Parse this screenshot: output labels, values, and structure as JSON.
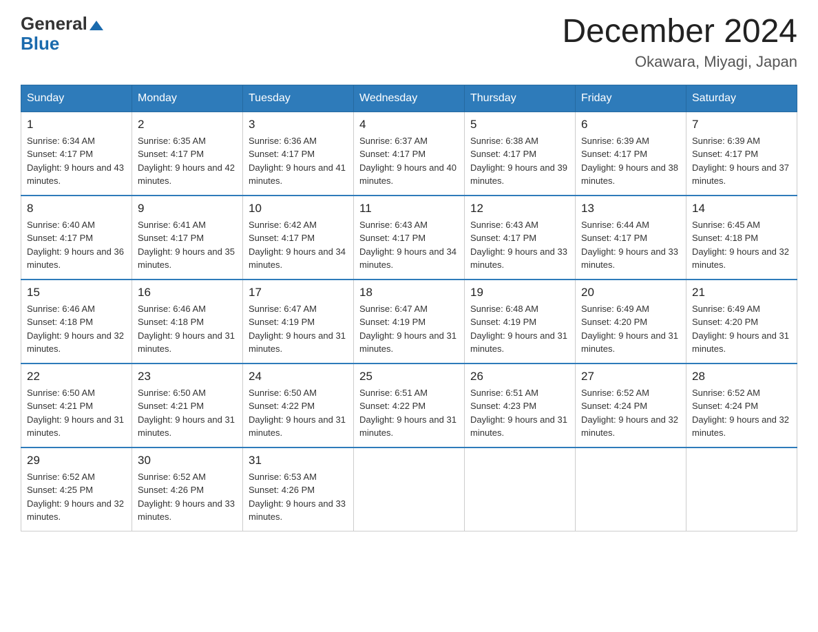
{
  "header": {
    "logo_general": "General",
    "logo_blue": "Blue",
    "month_title": "December 2024",
    "location": "Okawara, Miyagi, Japan"
  },
  "weekdays": [
    "Sunday",
    "Monday",
    "Tuesday",
    "Wednesday",
    "Thursday",
    "Friday",
    "Saturday"
  ],
  "weeks": [
    [
      {
        "day": "1",
        "sunrise": "6:34 AM",
        "sunset": "4:17 PM",
        "daylight": "9 hours and 43 minutes."
      },
      {
        "day": "2",
        "sunrise": "6:35 AM",
        "sunset": "4:17 PM",
        "daylight": "9 hours and 42 minutes."
      },
      {
        "day": "3",
        "sunrise": "6:36 AM",
        "sunset": "4:17 PM",
        "daylight": "9 hours and 41 minutes."
      },
      {
        "day": "4",
        "sunrise": "6:37 AM",
        "sunset": "4:17 PM",
        "daylight": "9 hours and 40 minutes."
      },
      {
        "day": "5",
        "sunrise": "6:38 AM",
        "sunset": "4:17 PM",
        "daylight": "9 hours and 39 minutes."
      },
      {
        "day": "6",
        "sunrise": "6:39 AM",
        "sunset": "4:17 PM",
        "daylight": "9 hours and 38 minutes."
      },
      {
        "day": "7",
        "sunrise": "6:39 AM",
        "sunset": "4:17 PM",
        "daylight": "9 hours and 37 minutes."
      }
    ],
    [
      {
        "day": "8",
        "sunrise": "6:40 AM",
        "sunset": "4:17 PM",
        "daylight": "9 hours and 36 minutes."
      },
      {
        "day": "9",
        "sunrise": "6:41 AM",
        "sunset": "4:17 PM",
        "daylight": "9 hours and 35 minutes."
      },
      {
        "day": "10",
        "sunrise": "6:42 AM",
        "sunset": "4:17 PM",
        "daylight": "9 hours and 34 minutes."
      },
      {
        "day": "11",
        "sunrise": "6:43 AM",
        "sunset": "4:17 PM",
        "daylight": "9 hours and 34 minutes."
      },
      {
        "day": "12",
        "sunrise": "6:43 AM",
        "sunset": "4:17 PM",
        "daylight": "9 hours and 33 minutes."
      },
      {
        "day": "13",
        "sunrise": "6:44 AM",
        "sunset": "4:17 PM",
        "daylight": "9 hours and 33 minutes."
      },
      {
        "day": "14",
        "sunrise": "6:45 AM",
        "sunset": "4:18 PM",
        "daylight": "9 hours and 32 minutes."
      }
    ],
    [
      {
        "day": "15",
        "sunrise": "6:46 AM",
        "sunset": "4:18 PM",
        "daylight": "9 hours and 32 minutes."
      },
      {
        "day": "16",
        "sunrise": "6:46 AM",
        "sunset": "4:18 PM",
        "daylight": "9 hours and 31 minutes."
      },
      {
        "day": "17",
        "sunrise": "6:47 AM",
        "sunset": "4:19 PM",
        "daylight": "9 hours and 31 minutes."
      },
      {
        "day": "18",
        "sunrise": "6:47 AM",
        "sunset": "4:19 PM",
        "daylight": "9 hours and 31 minutes."
      },
      {
        "day": "19",
        "sunrise": "6:48 AM",
        "sunset": "4:19 PM",
        "daylight": "9 hours and 31 minutes."
      },
      {
        "day": "20",
        "sunrise": "6:49 AM",
        "sunset": "4:20 PM",
        "daylight": "9 hours and 31 minutes."
      },
      {
        "day": "21",
        "sunrise": "6:49 AM",
        "sunset": "4:20 PM",
        "daylight": "9 hours and 31 minutes."
      }
    ],
    [
      {
        "day": "22",
        "sunrise": "6:50 AM",
        "sunset": "4:21 PM",
        "daylight": "9 hours and 31 minutes."
      },
      {
        "day": "23",
        "sunrise": "6:50 AM",
        "sunset": "4:21 PM",
        "daylight": "9 hours and 31 minutes."
      },
      {
        "day": "24",
        "sunrise": "6:50 AM",
        "sunset": "4:22 PM",
        "daylight": "9 hours and 31 minutes."
      },
      {
        "day": "25",
        "sunrise": "6:51 AM",
        "sunset": "4:22 PM",
        "daylight": "9 hours and 31 minutes."
      },
      {
        "day": "26",
        "sunrise": "6:51 AM",
        "sunset": "4:23 PM",
        "daylight": "9 hours and 31 minutes."
      },
      {
        "day": "27",
        "sunrise": "6:52 AM",
        "sunset": "4:24 PM",
        "daylight": "9 hours and 32 minutes."
      },
      {
        "day": "28",
        "sunrise": "6:52 AM",
        "sunset": "4:24 PM",
        "daylight": "9 hours and 32 minutes."
      }
    ],
    [
      {
        "day": "29",
        "sunrise": "6:52 AM",
        "sunset": "4:25 PM",
        "daylight": "9 hours and 32 minutes."
      },
      {
        "day": "30",
        "sunrise": "6:52 AM",
        "sunset": "4:26 PM",
        "daylight": "9 hours and 33 minutes."
      },
      {
        "day": "31",
        "sunrise": "6:53 AM",
        "sunset": "4:26 PM",
        "daylight": "9 hours and 33 minutes."
      },
      null,
      null,
      null,
      null
    ]
  ]
}
